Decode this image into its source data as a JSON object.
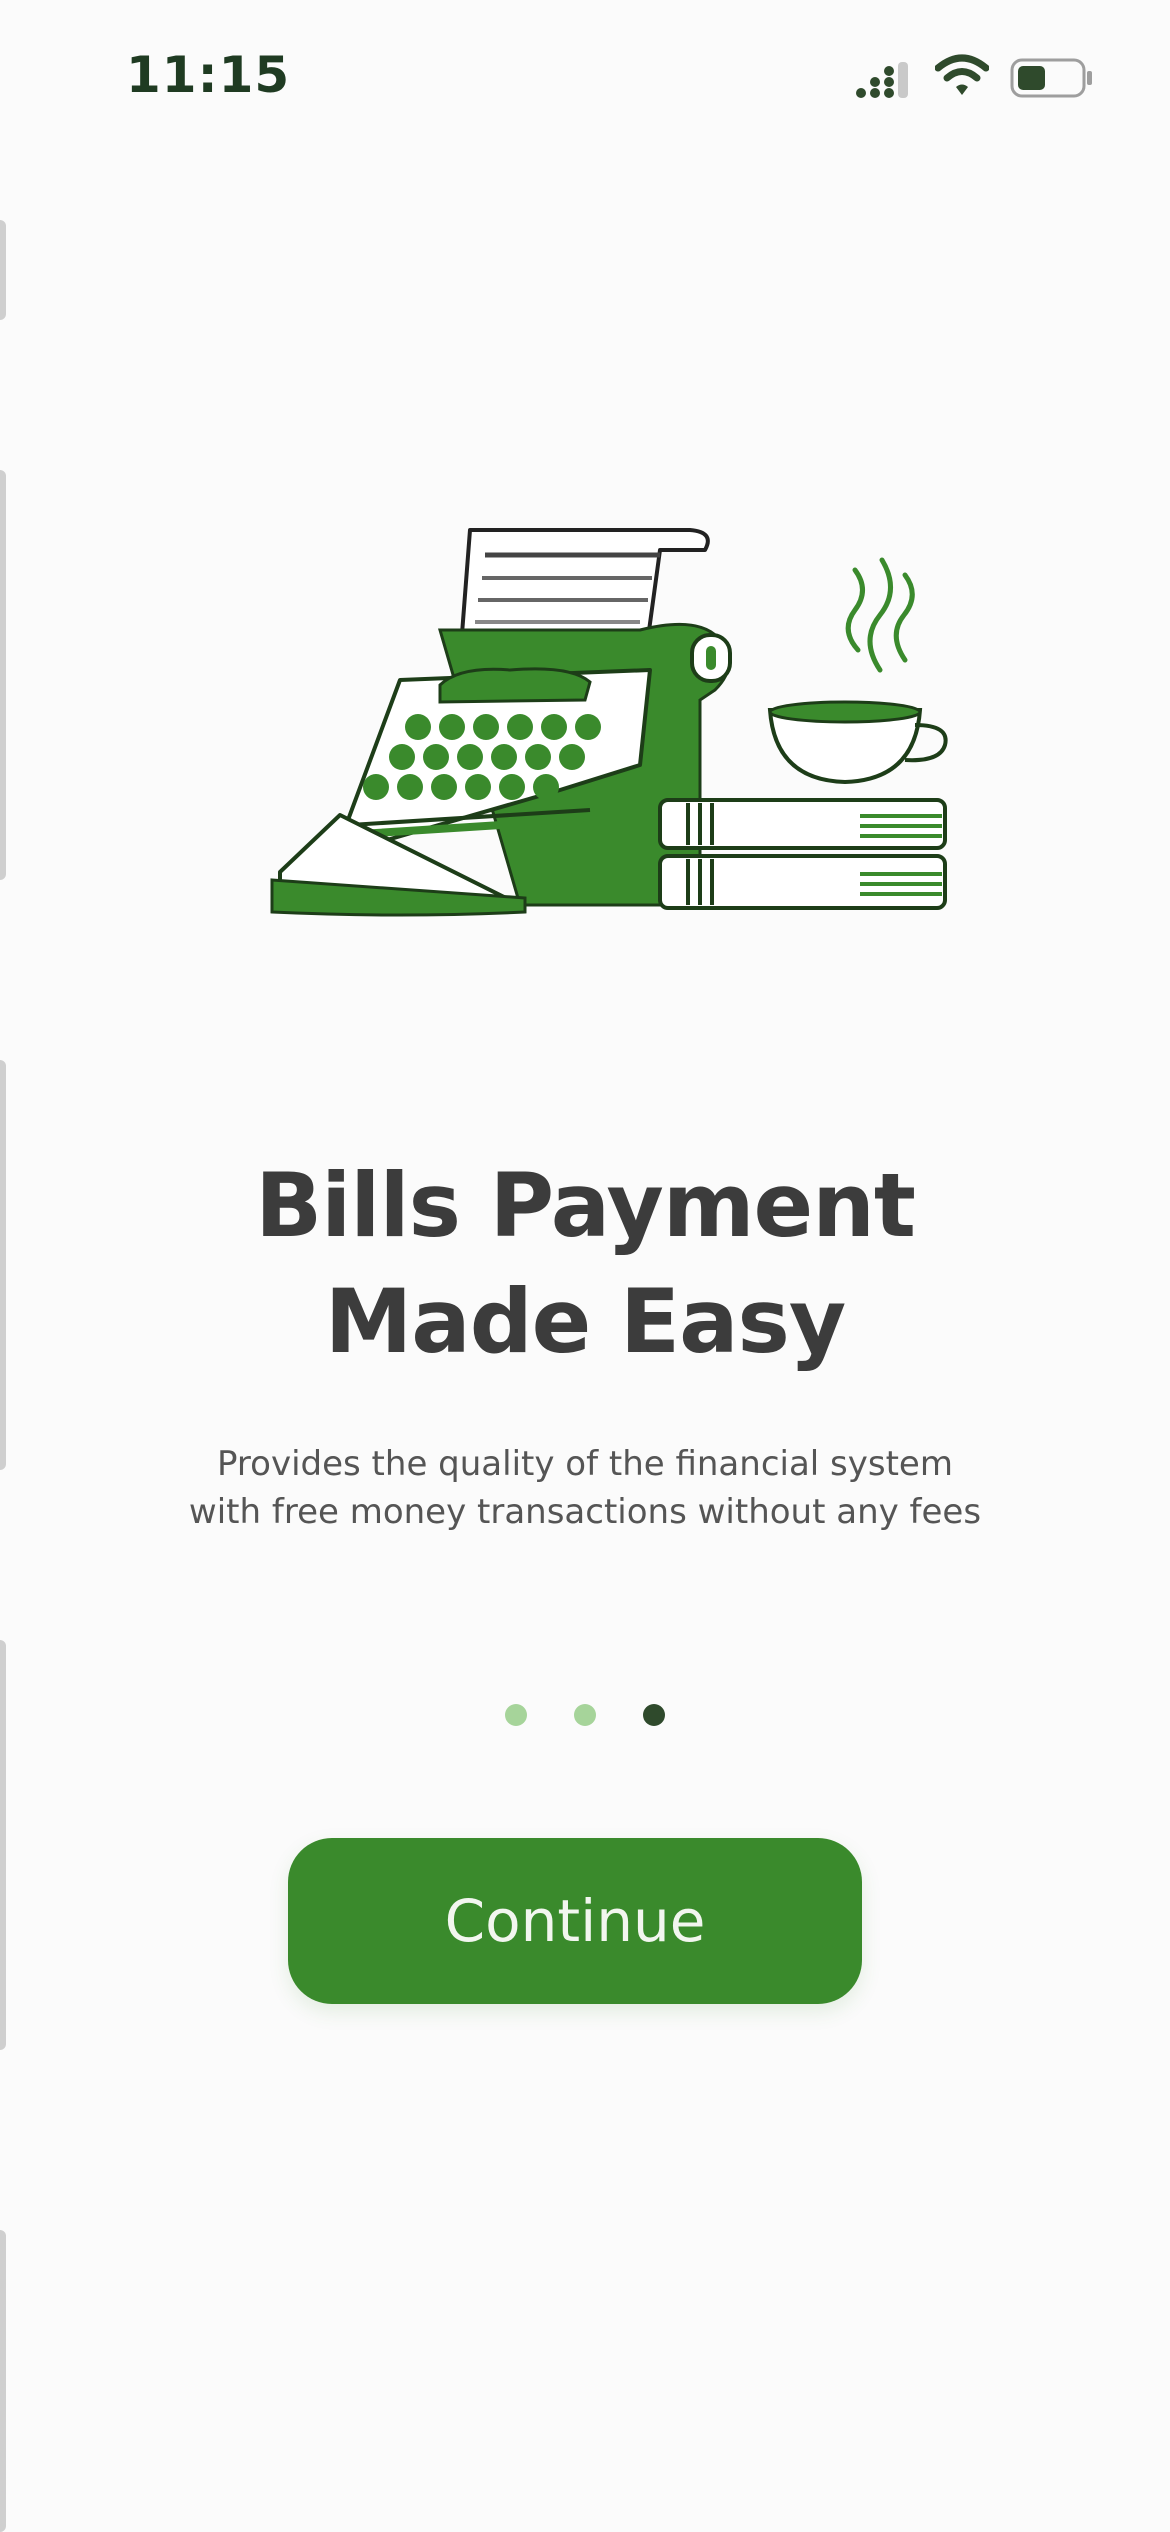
{
  "status_bar": {
    "time": "11:15",
    "signal_icon": "cellular-signal-icon",
    "wifi_icon": "wifi-icon",
    "battery_icon": "battery-icon",
    "battery_level": 0.45
  },
  "illustration": {
    "name": "typewriter-coffee-books-illustration",
    "accent": "#3a8a2c"
  },
  "onboarding": {
    "title_line1": "Bills Payment",
    "title_line2": "Made Easy",
    "subtitle_line1": "Provides the quality of the financial system",
    "subtitle_line2": "with free money transactions without any fees",
    "page_count": 3,
    "current_page": 3,
    "continue_label": "Continue"
  },
  "colors": {
    "accent": "#3a8a2c",
    "dot_inactive": "#a6d49a",
    "dot_active": "#2f4a2c",
    "title": "#3c3c3c",
    "subtitle": "#555555"
  }
}
